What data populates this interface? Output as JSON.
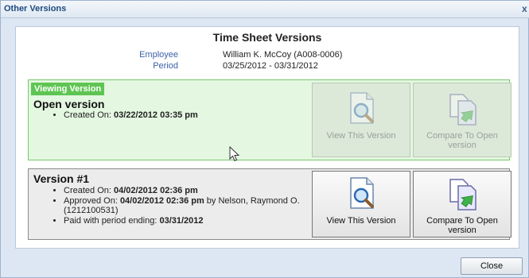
{
  "dialog": {
    "title": "Other Versions",
    "close_glyph": "x"
  },
  "main": {
    "heading": "Time Sheet Versions",
    "employee_label": "Employee",
    "employee_value": "William K. McCoy (A008-0006)",
    "period_label": "Period",
    "period_value": "03/25/2012 - 03/31/2012"
  },
  "viewing": {
    "badge": "Viewing Version",
    "title": "Open version",
    "created_prefix": "Created On: ",
    "created_value": "03/22/2012 03:35 pm",
    "view_button": "View This Version",
    "compare_button": "Compare To Open version"
  },
  "version1": {
    "title": "Version #1",
    "created_prefix": "Created On: ",
    "created_value": "04/02/2012 02:36 pm",
    "approved_prefix": "Approved On: ",
    "approved_value": "04/02/2012 02:36 pm",
    "approved_suffix": " by Nelson, Raymond O. (1212100531)",
    "paid_prefix": "Paid with period ending: ",
    "paid_value": "03/31/2012",
    "view_button": "View This Version",
    "compare_button": "Compare To Open version"
  },
  "footer": {
    "close_button": "Close"
  },
  "icons": {
    "view": "magnifier-document-icon",
    "compare": "compare-documents-icon",
    "cursor": "mouse-pointer-icon"
  },
  "colors": {
    "viewing_bg": "#e4f7e1",
    "viewing_border": "#76c76b",
    "badge_bg": "#5ec552",
    "label_blue": "#3a62a8"
  }
}
